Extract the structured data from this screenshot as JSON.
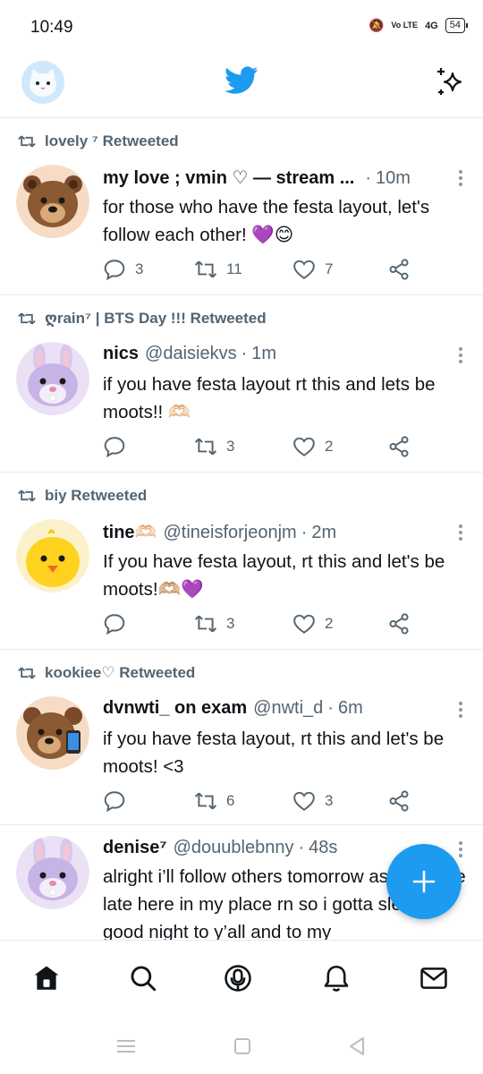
{
  "status_bar": {
    "time": "10:49",
    "volte": "Vo LTE",
    "signal": "4G",
    "battery": "54"
  },
  "top_bar": {
    "avatar_icon": "cat-face-avatar",
    "logo_icon": "twitter-bird-icon",
    "sparkle_icon": "sparkle-icon",
    "accent_color": "#1d9bf0"
  },
  "tweets": [
    {
      "retweeted_by": "lovely ⁷ Retweeted",
      "avatar": "bear-avatar",
      "name": "my love ; vmin ♡ — stream ...",
      "handle": "",
      "dot": "·",
      "time": "10m",
      "text": "for those who have the festa layout, let's follow each other! 💜😊",
      "replies": "3",
      "retweets": "11",
      "likes": "7"
    },
    {
      "retweeted_by": "ღrain⁷ | BTS Day !!! Retweeted",
      "avatar": "bunny-avatar",
      "name": "nics",
      "handle": "@daisiekvs",
      "dot": "·",
      "time": "1m",
      "text": "if you have festa layout rt this and lets be moots!! 🫶🏻",
      "replies": "",
      "retweets": "3",
      "likes": "2"
    },
    {
      "retweeted_by": "biy Retweeted",
      "avatar": "chick-avatar",
      "name": "tine🫶🏻",
      "handle": "@tineisforjeonjm",
      "dot": "·",
      "time": "2m",
      "text": "If you have festa layout, rt this and let's be moots!🫶🏼💜",
      "replies": "",
      "retweets": "3",
      "likes": "2"
    },
    {
      "retweeted_by": "kookiee♡ Retweeted",
      "avatar": "bear-phone-avatar",
      "name": "dvnwti_ on exam",
      "handle": "@nwti_d",
      "dot": "·",
      "time": "6m",
      "text": "if you have festa layout, rt this and let's be moots! <3",
      "replies": "",
      "retweets": "6",
      "likes": "3"
    },
    {
      "retweeted_by": "",
      "avatar": "bunny-avatar",
      "name": "denise⁷",
      "handle": "@douublebnny",
      "dot": "·",
      "time": "48s",
      "text": "alright i’ll follow others tomorrow as it is quite late here in my place rn so i gotta sleep!!! good night to y’all and to my",
      "replies": "",
      "retweets": "",
      "likes": ""
    }
  ],
  "fab": {
    "icon": "compose-plus-icon"
  },
  "bottom_nav": [
    "home-icon",
    "search-icon",
    "spaces-icon",
    "notifications-icon",
    "messages-icon"
  ],
  "system_nav": [
    "menu-icon",
    "home-square-icon",
    "back-icon"
  ]
}
